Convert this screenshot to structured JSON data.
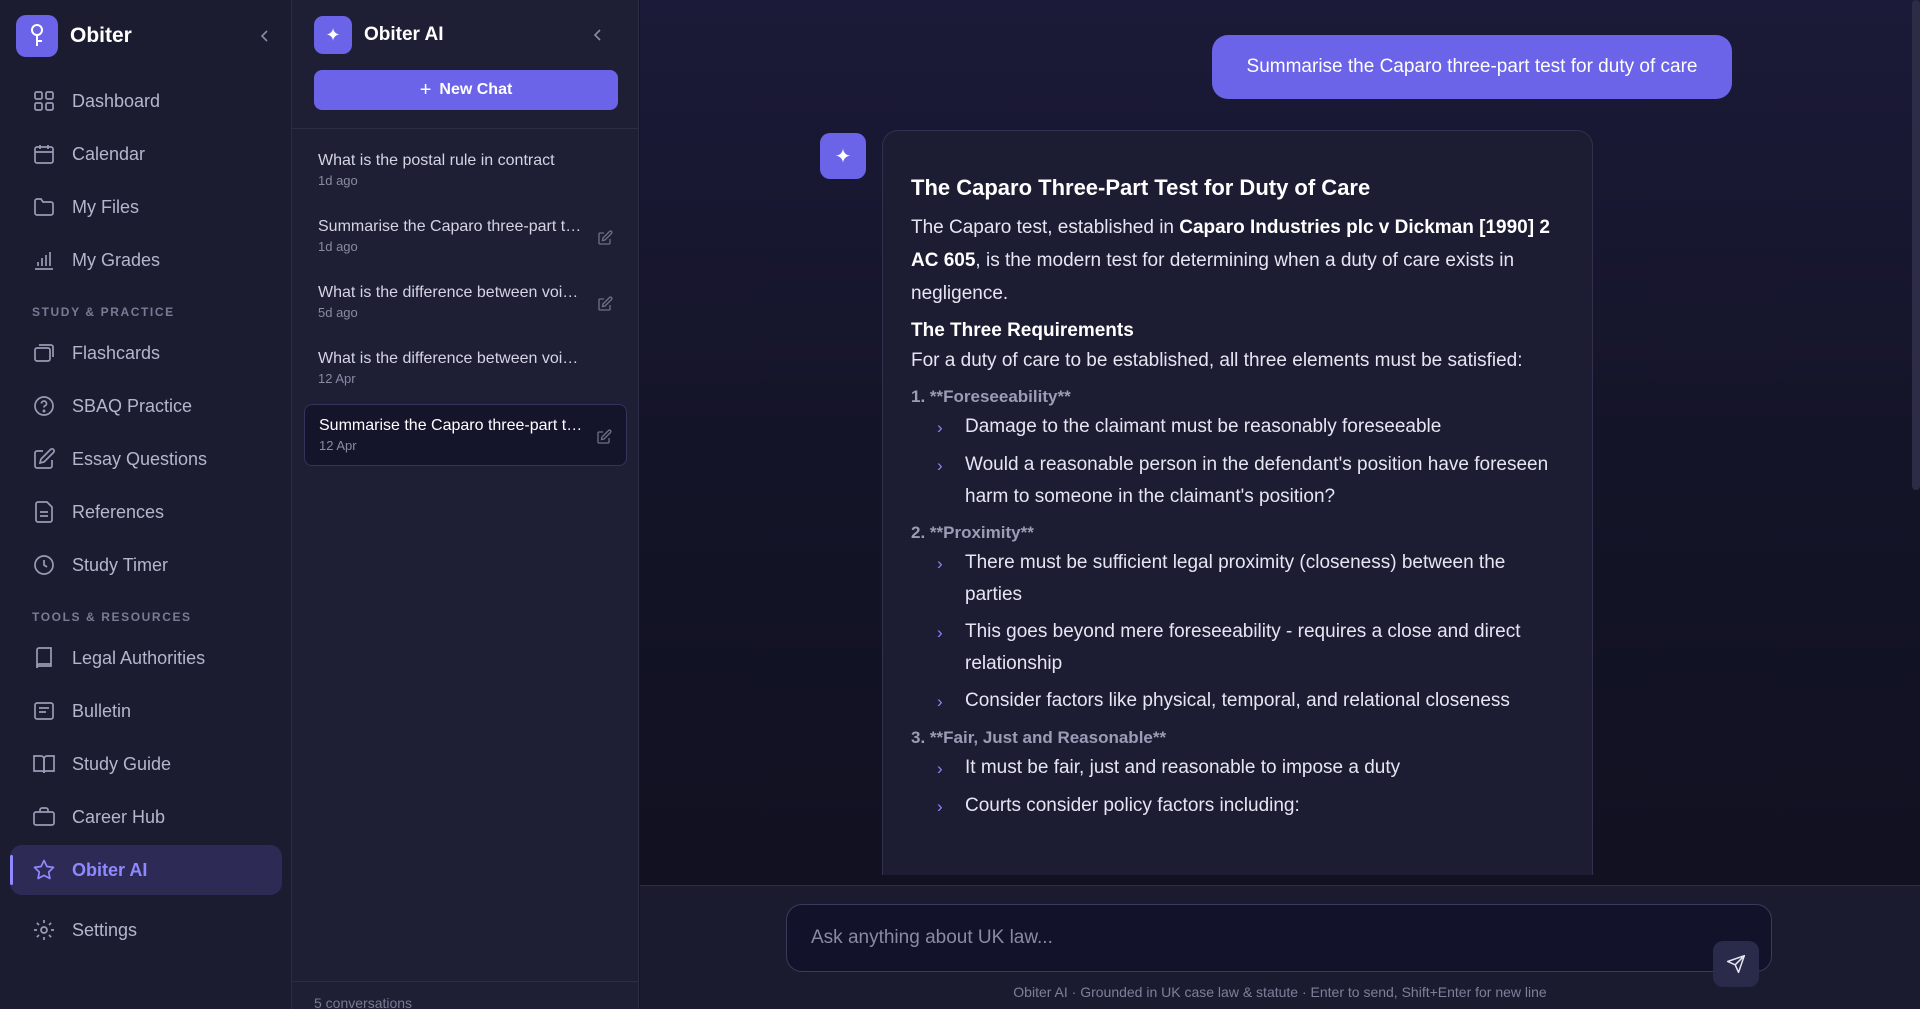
{
  "nav": {
    "brand": "Obiter",
    "items": [
      {
        "label": "Dashboard",
        "icon": "grid-icon"
      },
      {
        "label": "Calendar",
        "icon": "calendar-icon"
      },
      {
        "label": "My Files",
        "icon": "folder-icon"
      },
      {
        "label": "My Grades",
        "icon": "bar-chart-icon"
      }
    ],
    "study_section": "STUDY & PRACTICE",
    "study_items": [
      {
        "label": "Flashcards",
        "icon": "cards-icon"
      },
      {
        "label": "SBAQ Practice",
        "icon": "question-circle-icon"
      },
      {
        "label": "Essay Questions",
        "icon": "edit-icon"
      },
      {
        "label": "References",
        "icon": "document-icon"
      },
      {
        "label": "Study Timer",
        "icon": "clock-icon"
      }
    ],
    "tools_section": "TOOLS & RESOURCES",
    "tools_items": [
      {
        "label": "Legal Authorities",
        "icon": "book-icon"
      },
      {
        "label": "Bulletin",
        "icon": "newspaper-icon"
      },
      {
        "label": "Study Guide",
        "icon": "open-book-icon"
      },
      {
        "label": "Career Hub",
        "icon": "briefcase-icon"
      },
      {
        "label": "Obiter AI",
        "icon": "star-icon"
      }
    ],
    "settings": "Settings",
    "accent": "#8f88ff"
  },
  "chats": {
    "title": "Obiter AI",
    "new_chat": "New Chat",
    "conversations": [
      {
        "title": "What is the postal rule in contract",
        "time": "1d ago"
      },
      {
        "title": "Summarise the Caparo three-part test for duty of care",
        "time": "1d ago"
      },
      {
        "title": "What is the difference between void and voidable contracts",
        "time": "5d ago"
      },
      {
        "title": "What is the difference between void and voidable contracts",
        "time": "12 Apr"
      },
      {
        "title": "Summarise the Caparo three-part test for duty of care",
        "time": "12 Apr"
      }
    ],
    "count": "5 conversations"
  },
  "conversation": {
    "user_message": "Summarise the Caparo three-part test for duty of care",
    "answer": {
      "heading": "The Caparo Three-Part Test for Duty of Care",
      "intro_pre": "The Caparo test, established in ",
      "intro_case": "Caparo Industries plc v Dickman [1990] 2 AC 605",
      "intro_post": ", is the modern test for determining when a duty of care exists in negligence.",
      "subheading": "The Three Requirements",
      "lead": "For a duty of care to be established, all three elements must be satisfied:",
      "req1": "1. **Foreseeability**",
      "req1_points": [
        "Damage to the claimant must be reasonably foreseeable",
        "Would a reasonable person in the defendant's position have foreseen harm to someone in the claimant's position?"
      ],
      "req2": "2. **Proximity**",
      "req2_points": [
        "There must be sufficient legal proximity (closeness) between the parties",
        "This goes beyond mere foreseeability - requires a close and direct relationship",
        "Consider factors like physical, temporal, and relational closeness"
      ],
      "req3": "3. **Fair, Just and Reasonable**",
      "req3_points": [
        "It must be fair, just and reasonable to impose a duty",
        "Courts consider policy factors including:"
      ]
    }
  },
  "composer": {
    "placeholder": "Ask anything about UK law...",
    "footer": "Obiter AI · Grounded in UK case law & statute · Enter to send, Shift+Enter for new line"
  }
}
